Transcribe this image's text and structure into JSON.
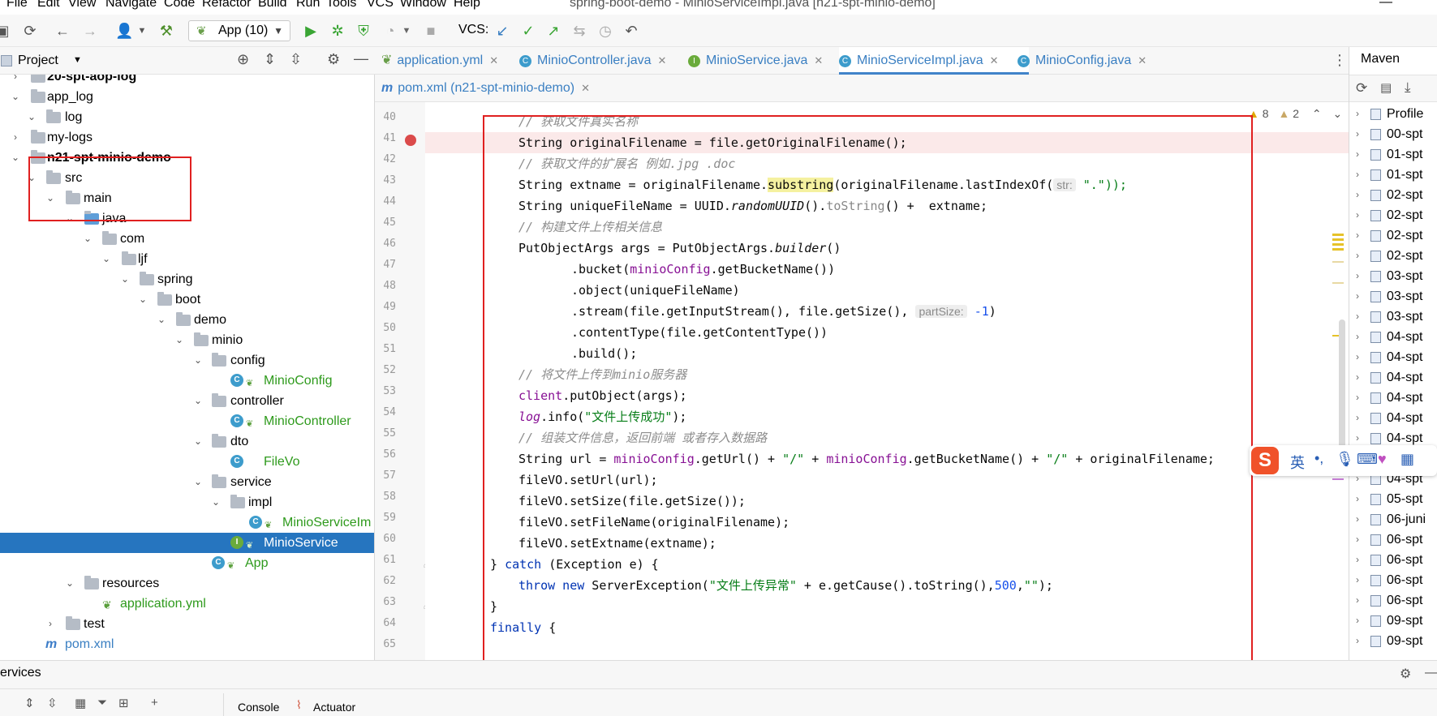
{
  "menu": [
    "File",
    "Edit",
    "View",
    "Navigate",
    "Code",
    "Refactor",
    "Build",
    "Run",
    "Tools",
    "VCS",
    "Window",
    "Help"
  ],
  "window_title": "spring-boot-demo - MinioServiceImpl.java [n21-spt-minio-demo]",
  "toolbar": {
    "run_config": "App (10)",
    "vcs_label": "VCS:"
  },
  "project_panel": {
    "title": "Project",
    "tree": [
      {
        "label": "20-spt-aop-log",
        "bold": true
      },
      {
        "label": "app_log"
      },
      {
        "label": "log"
      },
      {
        "label": "my-logs"
      },
      {
        "label": "n21-spt-minio-demo",
        "bold": true
      },
      {
        "label": "src"
      },
      {
        "label": "main"
      },
      {
        "label": "java"
      },
      {
        "label": "com"
      },
      {
        "label": "ljf"
      },
      {
        "label": "spring"
      },
      {
        "label": "boot"
      },
      {
        "label": "demo"
      },
      {
        "label": "minio"
      },
      {
        "label": "config"
      },
      {
        "label": "MinioConfig"
      },
      {
        "label": "controller"
      },
      {
        "label": "MinioController"
      },
      {
        "label": "dto"
      },
      {
        "label": "FileVo"
      },
      {
        "label": "service"
      },
      {
        "label": "impl"
      },
      {
        "label": "MinioServiceIm"
      },
      {
        "label": "MinioService",
        "selected": true
      },
      {
        "label": "App"
      },
      {
        "label": "resources"
      },
      {
        "label": "application.yml"
      },
      {
        "label": "test"
      },
      {
        "label": "pom.xml"
      }
    ]
  },
  "editor_tabs": [
    {
      "label": "application.yml"
    },
    {
      "label": "MinioController.java"
    },
    {
      "label": "MinioService.java"
    },
    {
      "label": "MinioServiceImpl.java",
      "active": true
    },
    {
      "label": "MinioConfig.java"
    }
  ],
  "editor_tabs_row2": [
    {
      "label": "pom.xml (n21-spt-minio-demo)"
    }
  ],
  "inspections": {
    "warnings": "8",
    "weak_warnings": "2"
  },
  "code": {
    "line_numbers": [
      "40",
      "41",
      "42",
      "43",
      "44",
      "45",
      "46",
      "47",
      "48",
      "49",
      "50",
      "51",
      "52",
      "53",
      "54",
      "55",
      "56",
      "57",
      "58",
      "59",
      "60",
      "61",
      "62",
      "63",
      "64",
      "65"
    ],
    "c40": "// 获取文件真实名称",
    "c41": "String originalFilename = file.getOriginalFilename();",
    "c42": "// 获取文件的扩展名 例如.jpg .doc",
    "c43a": "String extname = originalFilename.",
    "c43b": "substring",
    "c43c": "(originalFilename.lastIndexOf(",
    "c43hint": "str:",
    "c43d": " \".\"));",
    "c44a": "String uniqueFileName = UUID.",
    "c44b": "randomUUID",
    "c44c": "().",
    "c44d": "toString",
    "c44e": "() +  extname;",
    "c45": "// 构建文件上传相关信息",
    "c46a": "PutObjectArgs args = PutObjectArgs.",
    "c46b": "builder",
    "c46c": "()",
    "c47a": ".bucket(",
    "c47b": "minioConfig",
    "c47c": ".getBucketName())",
    "c48": ".object(uniqueFileName)",
    "c49a": ".stream(file.getInputStream(), file.getSize(), ",
    "c49hint": "partSize:",
    "c49b": " -1",
    "c49c": ")",
    "c50": ".contentType(file.getContentType())",
    "c51": ".build();",
    "c52": "// 将文件上传到minio服务器",
    "c53a": "client",
    "c53b": ".putObject(args);",
    "c54a": "log",
    "c54b": ".info(",
    "c54c": "\"文件上传成功\"",
    "c54d": ");",
    "c55": "// 组装文件信息，返回前端 或者存入数据路",
    "c56a": "String url = ",
    "c56b": "minioConfig",
    "c56c": ".getUrl() + ",
    "c56d": "\"/\"",
    "c56e": " + ",
    "c56f": "minioConfig",
    "c56g": ".getBucketName() + ",
    "c56h": "\"/\"",
    "c56i": " + originalFilename;",
    "c57": "fileVO.setUrl(url);",
    "c58": "fileVO.setSize(file.getSize());",
    "c59": "fileVO.setFileName(originalFilename);",
    "c60": "fileVO.setExtname(extname);",
    "c61a": "} ",
    "c61b": "catch",
    "c61c": " (Exception e) {",
    "c62a": "throw new",
    "c62b": " ServerException(",
    "c62c": "\"文件上传异常\"",
    "c62d": " + e.getCause().toString(),",
    "c62e": "500",
    "c62f": ",",
    "c62g": "\"\"",
    "c62h": ");",
    "c63": "}",
    "c64a": "finally",
    "c64b": " {"
  },
  "maven": {
    "title": "Maven",
    "items": [
      "Profile",
      "00-spt",
      "01-spt",
      "01-spt",
      "02-spt",
      "02-spt",
      "02-spt",
      "02-spt",
      "03-spt",
      "03-spt",
      "03-spt",
      "04-spt",
      "04-spt",
      "04-spt",
      "04-spt",
      "04-spt",
      "04-spt",
      "04-spt",
      "04-spt",
      "05-spt",
      "06-juni",
      "06-spt",
      "06-spt",
      "06-spt",
      "06-spt",
      "09-spt",
      "09-spt"
    ]
  },
  "bottom": {
    "services": "ervices",
    "console": "Console",
    "actuator": "Actuator"
  },
  "ime": {
    "lang": "英"
  },
  "colors": {
    "selection": "#2675bf",
    "red_box": "#e02020",
    "comment": "#8c8c8c",
    "keyword": "#0033b3",
    "string": "#067d17",
    "field": "#871094"
  }
}
